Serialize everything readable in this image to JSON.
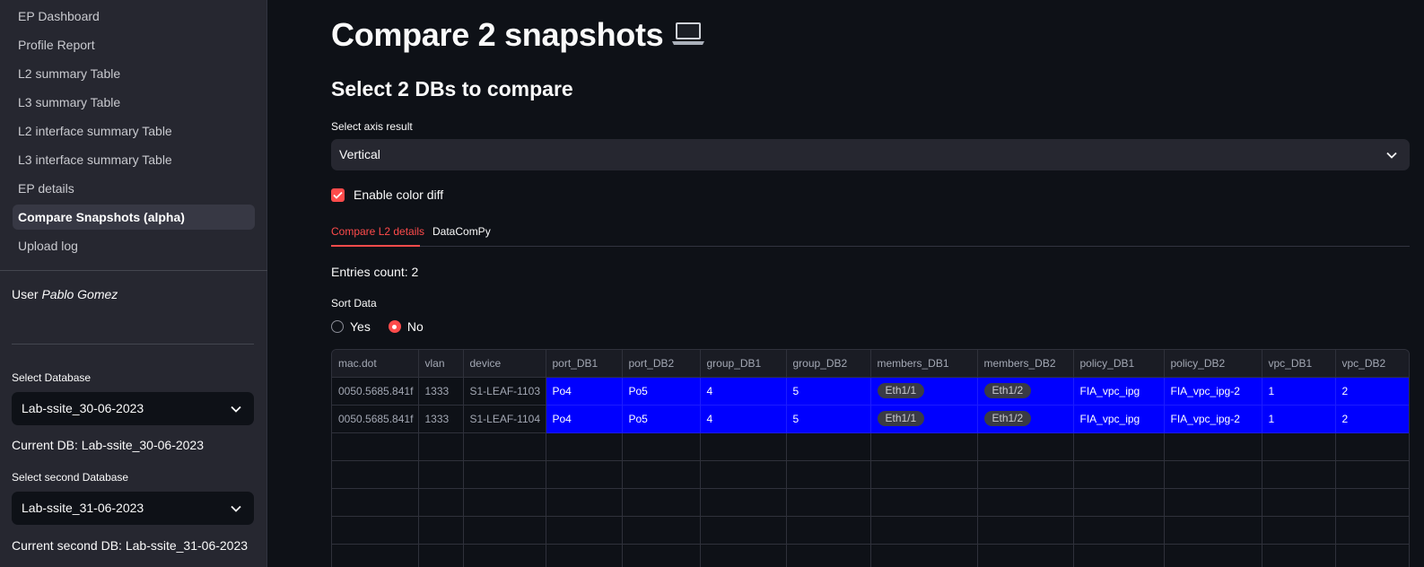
{
  "sidebar": {
    "nav": [
      {
        "label": "EP Dashboard",
        "active": false
      },
      {
        "label": "Profile Report",
        "active": false
      },
      {
        "label": "L2 summary Table",
        "active": false
      },
      {
        "label": "L3 summary Table",
        "active": false
      },
      {
        "label": "L2 interface summary Table",
        "active": false
      },
      {
        "label": "L3 interface summary Table",
        "active": false
      },
      {
        "label": "EP details",
        "active": false
      },
      {
        "label": "Compare Snapshots (alpha)",
        "active": true
      },
      {
        "label": "Upload log",
        "active": false
      }
    ],
    "user_prefix": "User",
    "user_name": "Pablo Gomez",
    "select_db_label": "Select Database",
    "select_db_value": "Lab-ssite_30-06-2023",
    "current_db": "Current DB: Lab-ssite_30-06-2023",
    "select_second_db_label": "Select second Database",
    "select_second_db_value": "Lab-ssite_31-06-2023",
    "current_second_db": "Current second DB: Lab-ssite_31-06-2023"
  },
  "main": {
    "title": "Compare 2 snapshots",
    "title_icon": "laptop-icon",
    "subtitle": "Select 2 DBs to compare",
    "axis_label": "Select axis result",
    "axis_value": "Vertical",
    "color_diff_label": "Enable color diff",
    "color_diff_checked": true,
    "tabs": [
      {
        "label": "Compare L2 details",
        "active": true
      },
      {
        "label": "DataComPy",
        "active": false
      }
    ],
    "entries_count": "Entries count: 2",
    "sort_label": "Sort Data",
    "sort_options": [
      "Yes",
      "No"
    ],
    "sort_selected": "No"
  },
  "table": {
    "columns": [
      "mac.dot",
      "vlan",
      "device",
      "port_DB1",
      "port_DB2",
      "group_DB1",
      "group_DB2",
      "members_DB1",
      "members_DB2",
      "policy_DB1",
      "policy_DB2",
      "vpc_DB1",
      "vpc_DB2"
    ],
    "rows": [
      [
        "0050.5685.841f",
        "1333",
        "S1-LEAF-1103",
        "Po4",
        "Po5",
        "4",
        "5",
        "Eth1/1",
        "Eth1/2",
        "FIA_vpc_ipg",
        "FIA_vpc_ipg-2",
        "1",
        "2"
      ],
      [
        "0050.5685.841f",
        "1333",
        "S1-LEAF-1104",
        "Po4",
        "Po5",
        "4",
        "5",
        "Eth1/1",
        "Eth1/2",
        "FIA_vpc_ipg",
        "FIA_vpc_ipg-2",
        "1",
        "2"
      ]
    ],
    "diff_color": "#0000ff"
  },
  "colors": {
    "accent": "#ff4b4b",
    "background": "#0e1117",
    "sidebar": "#262730"
  }
}
